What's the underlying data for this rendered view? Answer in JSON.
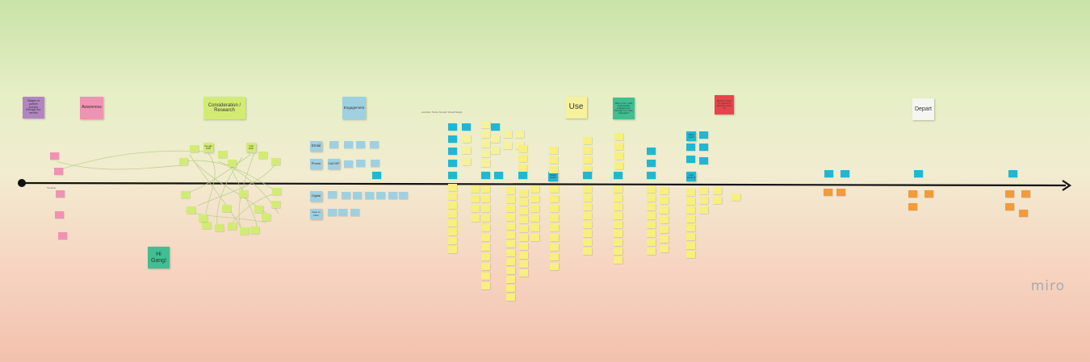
{
  "board": {
    "background_top": "#c9e3a7",
    "background_bottom": "#f3c1ad",
    "logo_text": "miro",
    "small_caption": "example: Name Groups Visual Design",
    "axis_caption": "Timeline"
  },
  "stages": {
    "intro": "Stages of partner journey through our service",
    "awareness": "Awareness",
    "consideration": "Consideration / Research",
    "engagement": "Engagement",
    "use": "Use",
    "question": "Who is our main stakeholder engagement through our main stategies?",
    "red_note": "Month 1 point for trial and decision point (!)",
    "depart": "Depart",
    "hi_gang": "Hi Gang!"
  },
  "channels": {
    "email": "Email",
    "phone": "Phone",
    "digital": "Digital",
    "face": "Face to Face",
    "call_dsp": "Call DSP",
    "google": "Google DSP",
    "call_dsp_2": "Call DSP",
    "what": "What next?",
    "stage": "Stage what?",
    "faq": "Faq stand Q"
  },
  "colors": {
    "purple": "#b186c0",
    "pink": "#ef93b3",
    "green_lime": "#d2ec73",
    "light_blue": "#9fd0e2",
    "pale_yellow": "#f6f19c",
    "yellow": "#f7ef7e",
    "cyan": "#1fb7d4",
    "teal": "#3fbf92",
    "red": "#e7454b",
    "orange": "#f29b3b",
    "white": "#f5f5f2"
  }
}
